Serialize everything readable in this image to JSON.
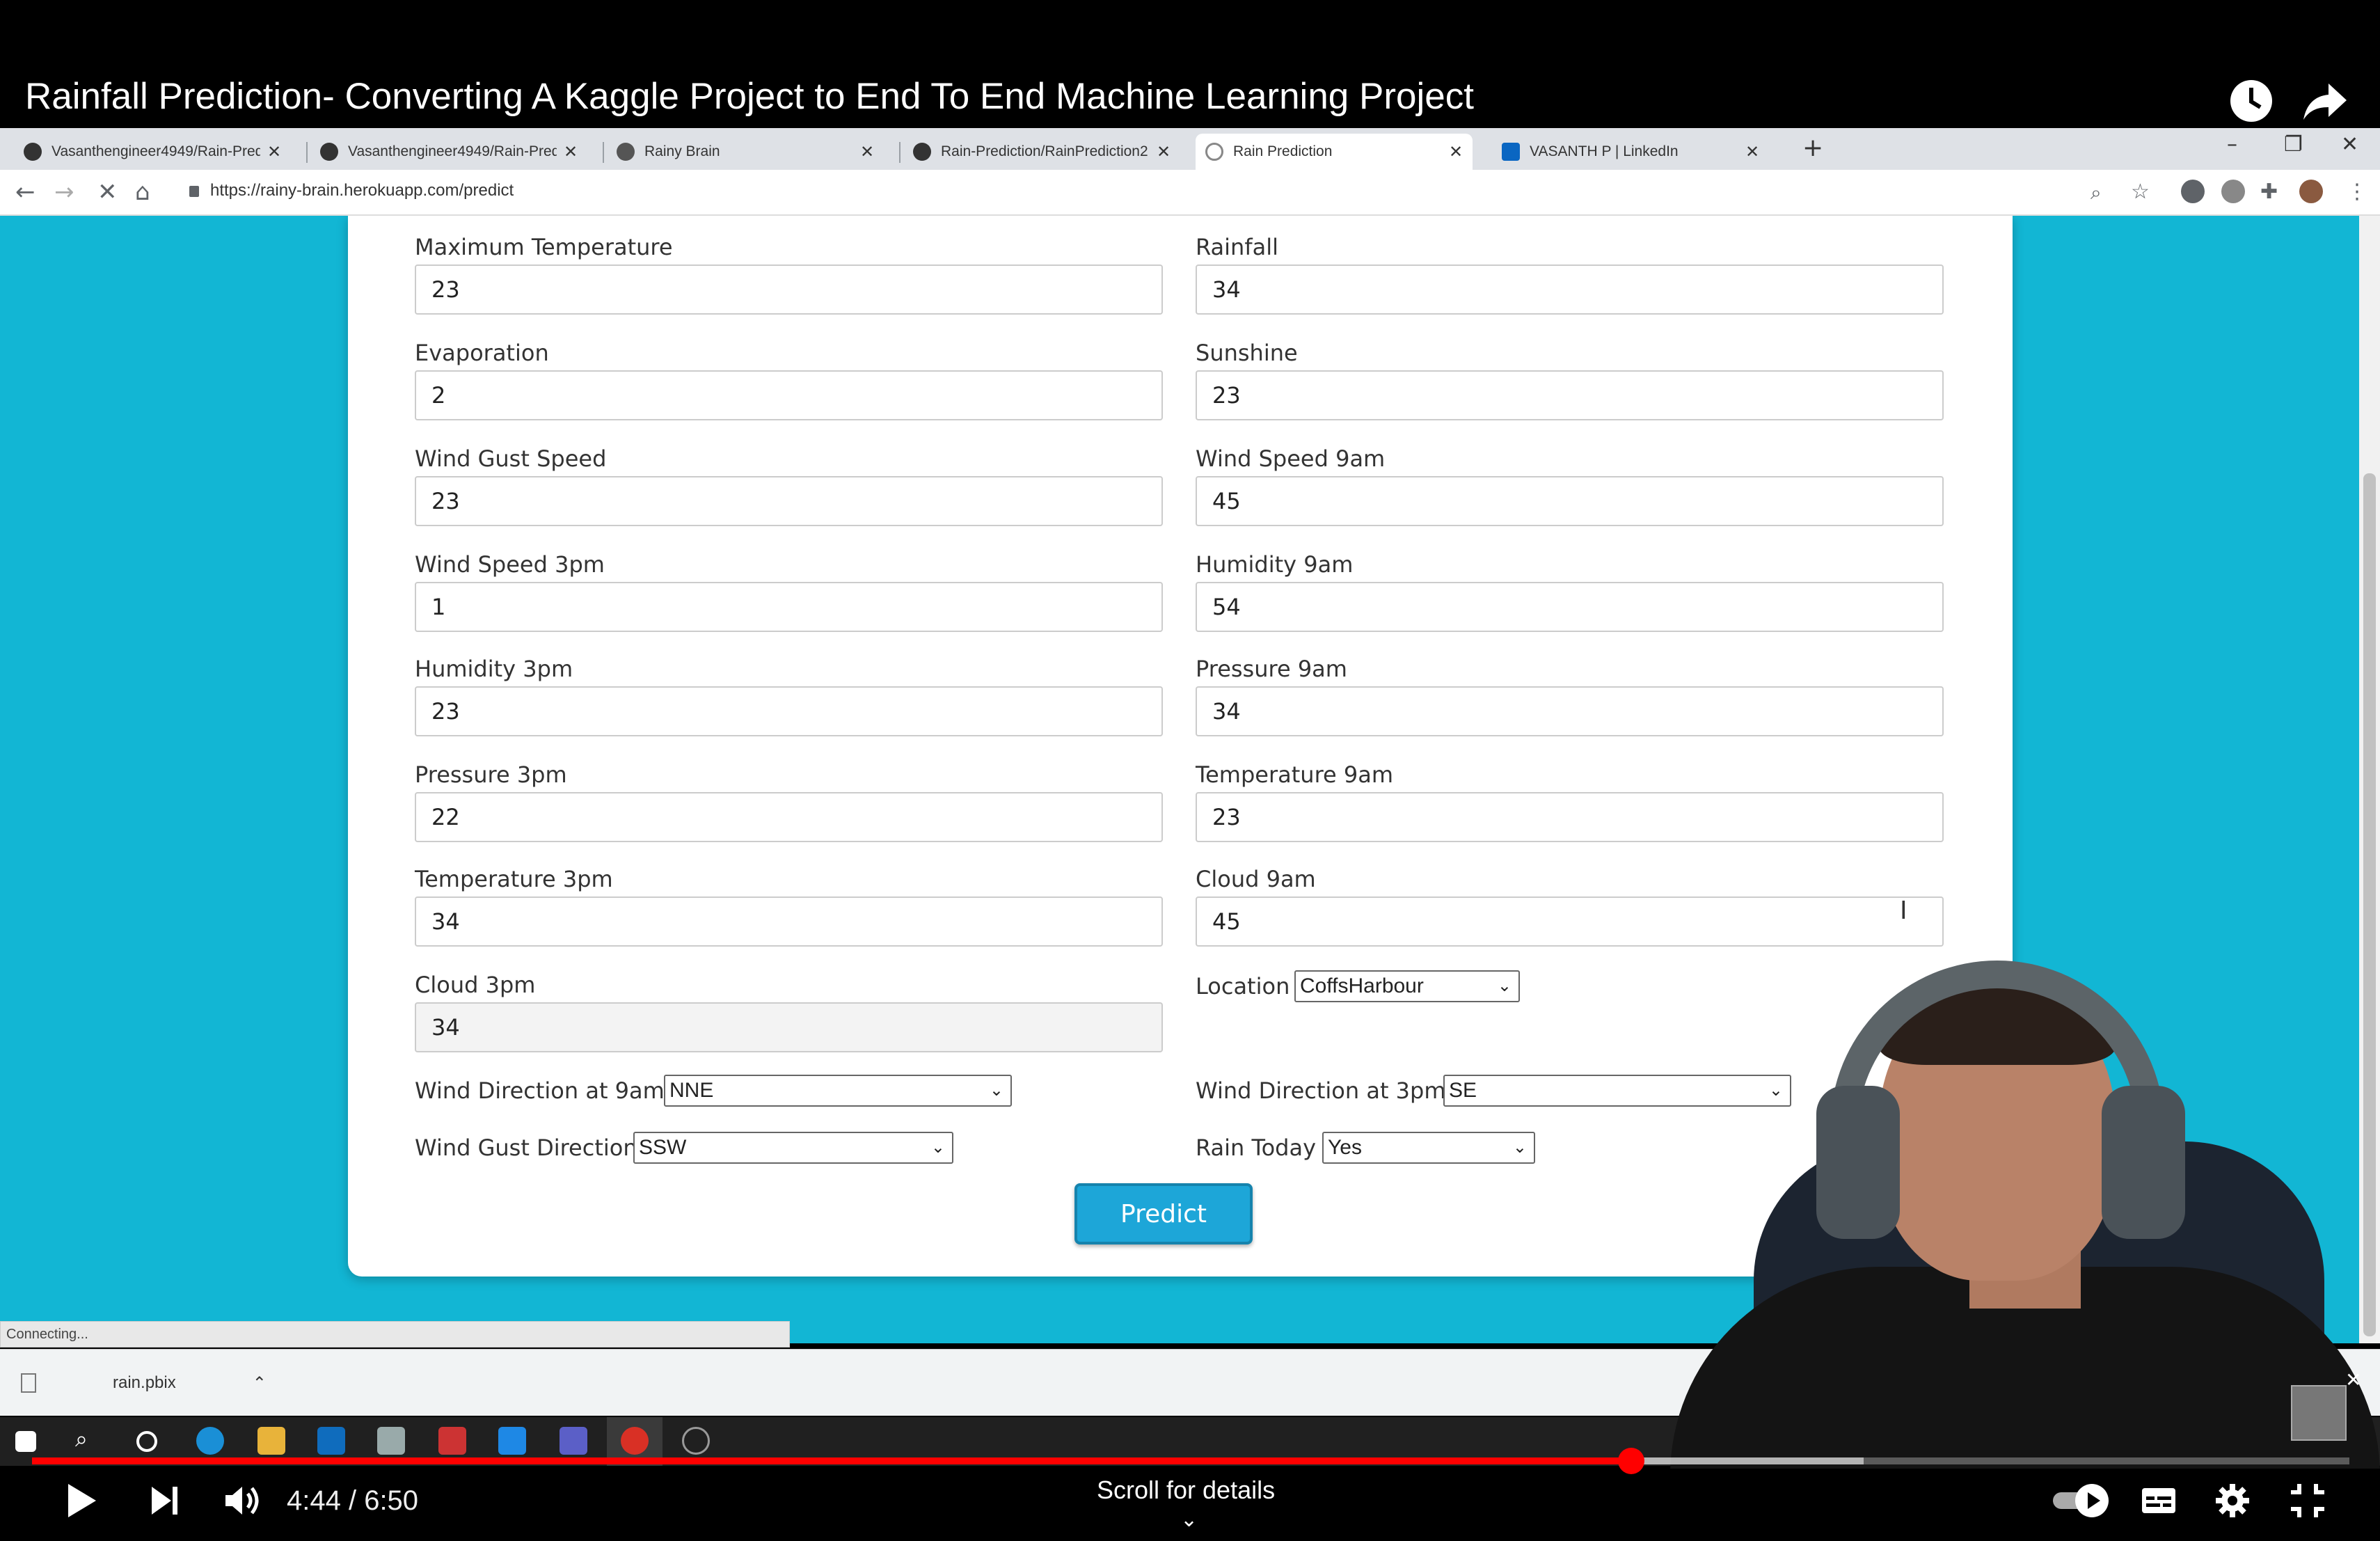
{
  "video": {
    "title": "Rainfall Prediction- Converting A Kaggle Project to End To End Machine Learning Project",
    "time": "4:44 / 6:50",
    "scroll_hint": "Scroll for details",
    "progress_fraction": 0.69
  },
  "browser": {
    "tabs": [
      {
        "label": "Vasanthengineer4949/Rain-Pred",
        "active": false
      },
      {
        "label": "Vasanthengineer4949/Rain-Pred",
        "active": false
      },
      {
        "label": "Rainy Brain",
        "active": false
      },
      {
        "label": "Rain-Prediction/RainPrediction2",
        "active": false
      },
      {
        "label": "Rain Prediction",
        "active": true
      },
      {
        "label": "VASANTH P | LinkedIn",
        "active": false
      }
    ],
    "url": "https://rainy-brain.herokuapp.com/predict",
    "status": "Connecting...",
    "download": "rain.pbix"
  },
  "form": {
    "left": [
      {
        "label": "Maximum Temperature",
        "value": "23"
      },
      {
        "label": "Evaporation",
        "value": "2"
      },
      {
        "label": "Wind Gust Speed",
        "value": "23"
      },
      {
        "label": "Wind Speed 3pm",
        "value": "1"
      },
      {
        "label": "Humidity 3pm",
        "value": "23"
      },
      {
        "label": "Pressure 3pm",
        "value": "22"
      },
      {
        "label": "Temperature 3pm",
        "value": "34"
      },
      {
        "label": "Cloud 3pm",
        "value": "34"
      }
    ],
    "right": [
      {
        "label": "Rainfall",
        "value": "34"
      },
      {
        "label": "Sunshine",
        "value": "23"
      },
      {
        "label": "Wind Speed 9am",
        "value": "45"
      },
      {
        "label": "Humidity 9am",
        "value": "54"
      },
      {
        "label": "Pressure 9am",
        "value": "34"
      },
      {
        "label": "Temperature 9am",
        "value": "23"
      },
      {
        "label": "Cloud 9am",
        "value": "45"
      }
    ],
    "location": {
      "label": "Location",
      "value": "CoffsHarbour"
    },
    "wind_dir_9am": {
      "label": "Wind Direction at 9am",
      "value": "NNE"
    },
    "wind_dir_3pm": {
      "label": "Wind Direction at 3pm",
      "value": "SE"
    },
    "wind_gust_dir": {
      "label": "Wind Gust Direction",
      "value": "SSW"
    },
    "rain_today": {
      "label": "Rain Today",
      "value": "Yes"
    },
    "predict_label": "Predict"
  },
  "colors": {
    "page_bg": "#12b6d4",
    "button": "#1da6d8",
    "progress": "#ff0000"
  }
}
